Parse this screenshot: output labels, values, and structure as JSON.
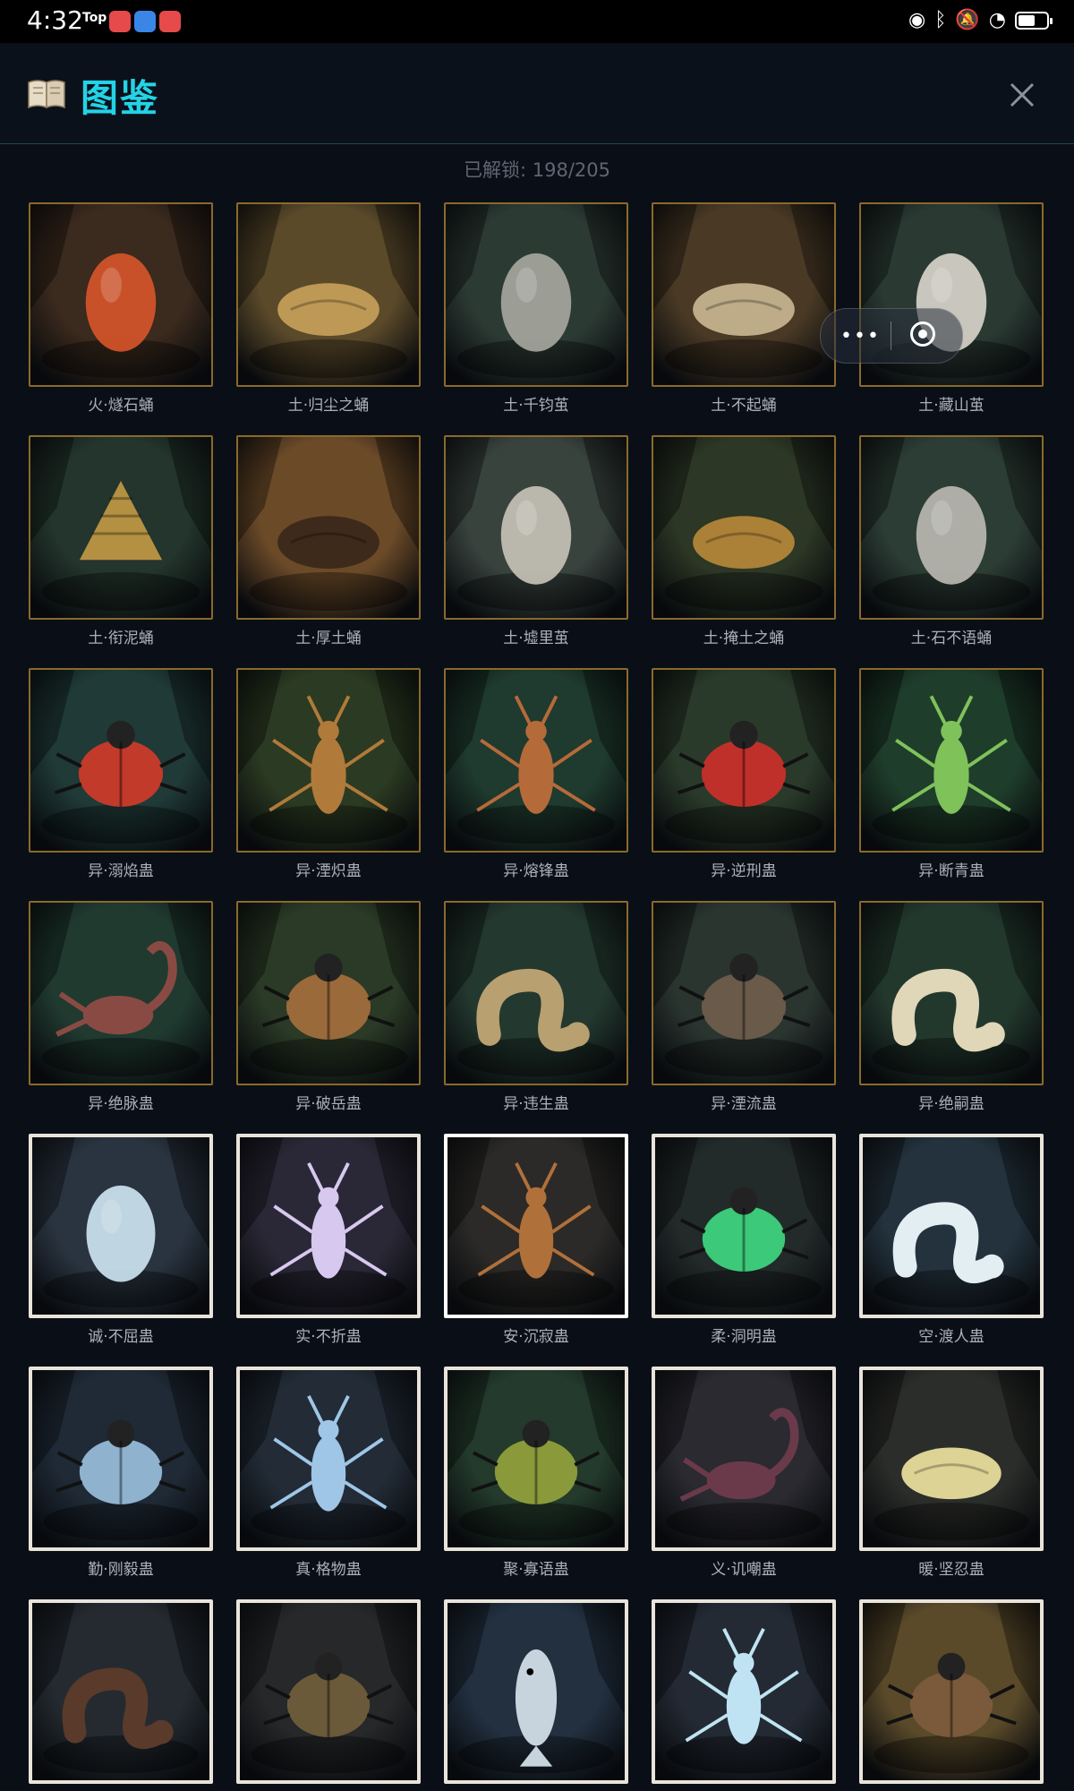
{
  "status_bar": {
    "time": "4:32",
    "top_badge": "Top"
  },
  "header": {
    "title": "图鉴",
    "unlock_text": "已解锁: 198/205"
  },
  "creatures": [
    {
      "label": "火·燧石蛹",
      "frame": "gold",
      "bg": "#3b2a1e",
      "accent": "#d8552a",
      "shape": "egg"
    },
    {
      "label": "土·归尘之蛹",
      "frame": "gold",
      "bg": "#5b4a2a",
      "accent": "#c9a25a",
      "shape": "pupa"
    },
    {
      "label": "土·千钧茧",
      "frame": "gold",
      "bg": "#2c3a34",
      "accent": "#a9a9a0",
      "shape": "egg"
    },
    {
      "label": "土·不起蛹",
      "frame": "gold",
      "bg": "#4a3a25",
      "accent": "#cbb995",
      "shape": "pupa"
    },
    {
      "label": "土·藏山茧",
      "frame": "gold",
      "bg": "#2a3a33",
      "accent": "#d9d6cc",
      "shape": "egg"
    },
    {
      "label": "土·衔泥蛹",
      "frame": "gold",
      "bg": "#23352c",
      "accent": "#c49a45",
      "shape": "hive"
    },
    {
      "label": "土·厚土蛹",
      "frame": "gold",
      "bg": "#6b4a28",
      "accent": "#3a2718",
      "shape": "pupa"
    },
    {
      "label": "土·墟里茧",
      "frame": "gold",
      "bg": "#39433e",
      "accent": "#c9c4b8",
      "shape": "egg"
    },
    {
      "label": "土·掩土之蛹",
      "frame": "gold",
      "bg": "#2c3725",
      "accent": "#b98a3a",
      "shape": "pupa"
    },
    {
      "label": "土·石不语蛹",
      "frame": "gold",
      "bg": "#2c3d35",
      "accent": "#bdbab2",
      "shape": "egg"
    },
    {
      "label": "异·溺焰蛊",
      "frame": "gold",
      "bg": "#1f3a37",
      "accent": "#c23a2a",
      "shape": "beetle"
    },
    {
      "label": "异·湮炽蛊",
      "frame": "gold",
      "bg": "#2b3a22",
      "accent": "#b07a3a",
      "shape": "insect"
    },
    {
      "label": "异·熔锋蛊",
      "frame": "gold",
      "bg": "#1f3a2e",
      "accent": "#b56a3a",
      "shape": "insect"
    },
    {
      "label": "异·逆刑蛊",
      "frame": "gold",
      "bg": "#2a3a2a",
      "accent": "#c0302a",
      "shape": "beetle"
    },
    {
      "label": "异·断青蛊",
      "frame": "gold",
      "bg": "#1f3d2b",
      "accent": "#7fc25a",
      "shape": "insect"
    },
    {
      "label": "异·绝脉蛊",
      "frame": "gold",
      "bg": "#203a30",
      "accent": "#8a4a44",
      "shape": "scorpion"
    },
    {
      "label": "异·破岳蛊",
      "frame": "gold",
      "bg": "#2a3a26",
      "accent": "#9a6a3a",
      "shape": "beetle"
    },
    {
      "label": "异·违生蛊",
      "frame": "gold",
      "bg": "#23382f",
      "accent": "#b8a070",
      "shape": "worm"
    },
    {
      "label": "异·湮流蛊",
      "frame": "gold",
      "bg": "#2a3530",
      "accent": "#6a5a4a",
      "shape": "beetle"
    },
    {
      "label": "异·绝嗣蛊",
      "frame": "gold",
      "bg": "#22382d",
      "accent": "#e0d6b8",
      "shape": "worm"
    },
    {
      "label": "诚·不屈蛊",
      "frame": "bone",
      "bg": "#2a3440",
      "accent": "#cfe7f3",
      "shape": "egg"
    },
    {
      "label": "实·不折蛊",
      "frame": "bone",
      "bg": "#2a2836",
      "accent": "#d7c8f0",
      "shape": "insect"
    },
    {
      "label": "安·沉寂蛊",
      "frame": "white",
      "bg": "#2b2a28",
      "accent": "#b0703a",
      "shape": "insect"
    },
    {
      "label": "柔·洞明蛊",
      "frame": "bone",
      "bg": "#232a2a",
      "accent": "#3cc97a",
      "shape": "beetle"
    },
    {
      "label": "空·渡人蛊",
      "frame": "bone",
      "bg": "#23323d",
      "accent": "#e3eef2",
      "shape": "worm"
    },
    {
      "label": "勤·刚毅蛊",
      "frame": "bone",
      "bg": "#1f2a36",
      "accent": "#8fb2cf",
      "shape": "beetle"
    },
    {
      "label": "真·格物蛊",
      "frame": "bone",
      "bg": "#222b36",
      "accent": "#9fc6e6",
      "shape": "insect"
    },
    {
      "label": "聚·寡语蛊",
      "frame": "bone",
      "bg": "#233a2c",
      "accent": "#8a9a3a",
      "shape": "beetle"
    },
    {
      "label": "义·讥嘲蛊",
      "frame": "bone",
      "bg": "#2a2a30",
      "accent": "#6a3a4a",
      "shape": "scorpion"
    },
    {
      "label": "暖·坚忍蛊",
      "frame": "bone",
      "bg": "#2b2d2a",
      "accent": "#f0e6a0",
      "shape": "pupa"
    },
    {
      "label": "",
      "frame": "bone",
      "bg": "#242a30",
      "accent": "#5a3a2a",
      "shape": "worm"
    },
    {
      "label": "",
      "frame": "bone",
      "bg": "#26282a",
      "accent": "#6a5a3a",
      "shape": "beetle"
    },
    {
      "label": "",
      "frame": "bone",
      "bg": "#223040",
      "accent": "#c7d4dd",
      "shape": "fish"
    },
    {
      "label": "",
      "frame": "bone",
      "bg": "#242a34",
      "accent": "#bfe3f3",
      "shape": "insect"
    },
    {
      "label": "",
      "frame": "bone",
      "bg": "#5a4a2a",
      "accent": "#7a5a3a",
      "shape": "beetle"
    }
  ],
  "icons": {
    "book": "book-icon",
    "close": "close-icon",
    "more": "more-icon",
    "target": "target-icon"
  }
}
